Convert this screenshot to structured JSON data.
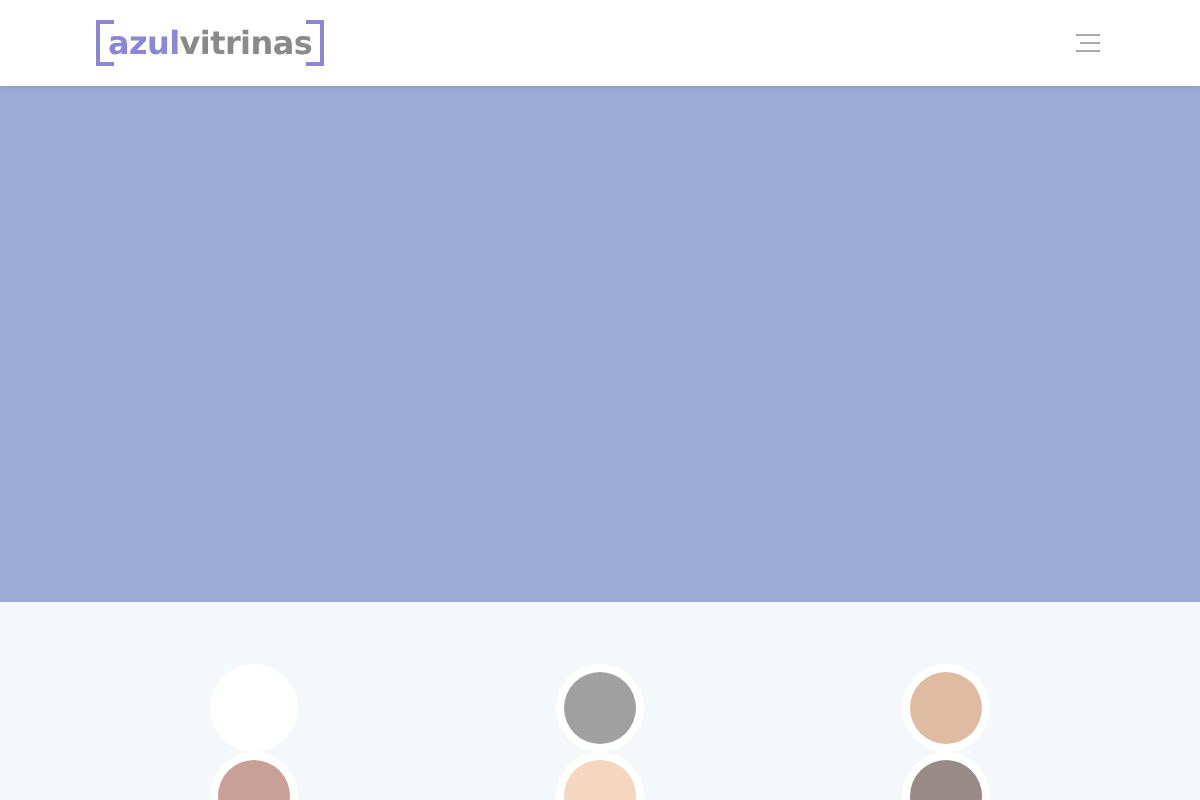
{
  "header": {
    "logo": {
      "accent": "azul",
      "rest": "vitrinas"
    }
  },
  "swatches": [
    {
      "color": "#ffffff"
    },
    {
      "color": "#a0a0a0"
    },
    {
      "color": "#dfbba2"
    },
    {
      "color": "#c9a097"
    },
    {
      "color": "#f5d6bf"
    },
    {
      "color": "#978a88"
    }
  ]
}
